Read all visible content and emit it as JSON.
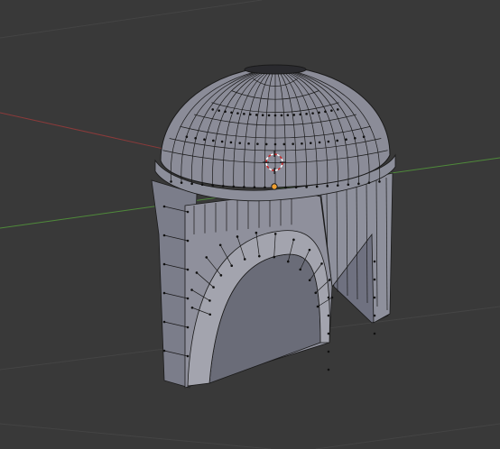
{
  "viewport": {
    "background": "#393939",
    "grid_color": "#444444",
    "axis_x_color": "#8a3a3a",
    "axis_y_color": "#4f8a3a",
    "mesh_face_color": "#8b8c98",
    "mesh_face_shadow": "#6c6e7a",
    "mesh_face_light": "#a6a7b1",
    "mesh_edge_color": "#1a1a1a",
    "vertex_color": "#111111",
    "cursor_color": "#cc2222",
    "origin_color": "#f0a030"
  },
  "scene": {
    "object": "helmet-mesh",
    "mode": "edit",
    "icons": {
      "cursor": "3d-cursor-icon",
      "origin": "object-origin-icon"
    }
  }
}
